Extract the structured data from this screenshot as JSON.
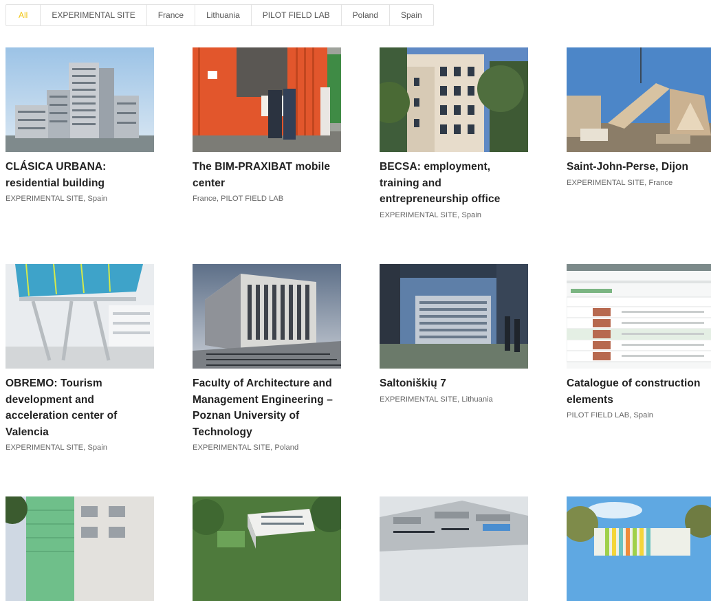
{
  "filters": [
    {
      "label": "All",
      "active": true
    },
    {
      "label": "EXPERIMENTAL SITE"
    },
    {
      "label": "France"
    },
    {
      "label": "Lithuania"
    },
    {
      "label": "PILOT FIELD LAB"
    },
    {
      "label": "Poland"
    },
    {
      "label": "Spain"
    }
  ],
  "projects": [
    {
      "title": "CLÁSICA URBANA: residential building",
      "tags": "EXPERIMENTAL SITE, Spain",
      "image": "residential-tower-render"
    },
    {
      "title": "The BIM-PRAXIBAT mobile center",
      "tags": "France, PILOT FIELD LAB",
      "image": "orange-container-lab-photo"
    },
    {
      "title": "BECSA: employment, training and entrepreneurship office",
      "tags": "EXPERIMENTAL SITE, Spain",
      "image": "office-building-photo"
    },
    {
      "title": "Saint-John-Perse, Dijon",
      "tags": "EXPERIMENTAL SITE, France",
      "image": "timber-panel-crane-photo"
    },
    {
      "title": "OBREMO: Tourism development and acceleration center of Valencia",
      "tags": "EXPERIMENTAL SITE, Spain",
      "image": "bim-facade-render"
    },
    {
      "title": "Faculty of Architecture and Management Engineering – Poznan University of Technology",
      "tags": "EXPERIMENTAL SITE, Poland",
      "image": "faculty-building-render"
    },
    {
      "title": "Saltoniškių 7",
      "tags": "EXPERIMENTAL SITE, Lithuania",
      "image": "glass-office-render"
    },
    {
      "title": "Catalogue of construction elements",
      "tags": "PILOT FIELD LAB, Spain",
      "image": "catalogue-table-screenshot"
    },
    {
      "title": "",
      "tags": "",
      "image": "scaffold-facade-photo"
    },
    {
      "title": "",
      "tags": "",
      "image": "campus-aerial-render"
    },
    {
      "title": "",
      "tags": "",
      "image": "industrial-roof-render"
    },
    {
      "title": "",
      "tags": "",
      "image": "colorful-facade-render"
    }
  ]
}
